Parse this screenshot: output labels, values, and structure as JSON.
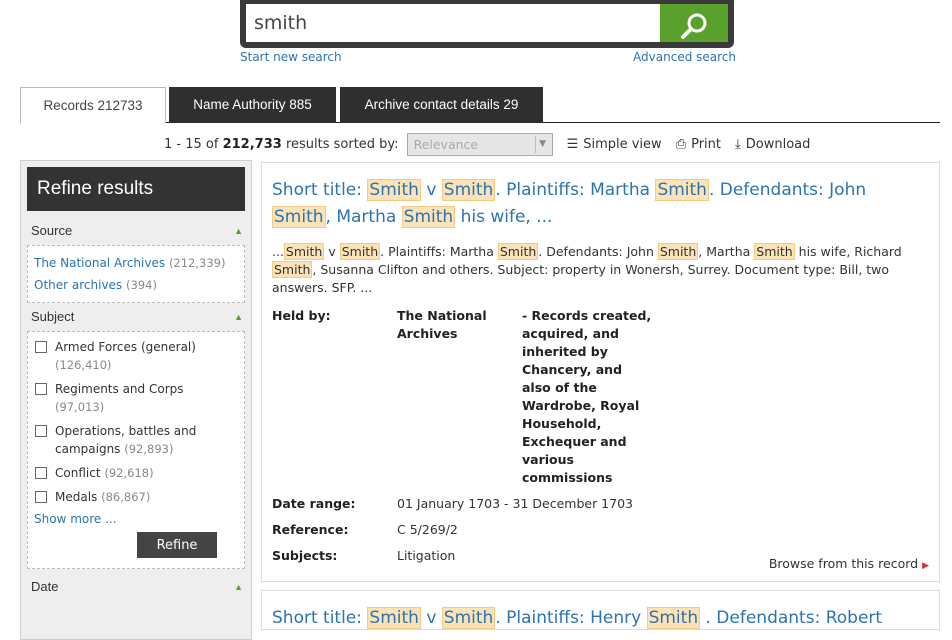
{
  "search": {
    "query": "smith",
    "start_new": "Start new search",
    "advanced": "Advanced search"
  },
  "tabs": [
    {
      "label": "Records 212733"
    },
    {
      "label": "Name Authority 885"
    },
    {
      "label": "Archive contact details 29"
    }
  ],
  "results_bar": {
    "range": "1 - 15 of",
    "total": "212,733",
    "sorted_by": "results sorted by:",
    "sort_value": "Relevance",
    "simple_view": "Simple view",
    "print": "Print",
    "download": "Download"
  },
  "sidebar": {
    "heading": "Refine results",
    "source": {
      "title": "Source",
      "items": [
        {
          "label": "The National Archives",
          "count": "(212,339)"
        },
        {
          "label": "Other archives",
          "count": "(394)"
        }
      ]
    },
    "subject": {
      "title": "Subject",
      "items": [
        {
          "label": "Armed Forces (general)",
          "count": "(126,410)"
        },
        {
          "label": "Regiments and Corps",
          "count": "(97,013)"
        },
        {
          "label": "Operations, battles and campaigns",
          "count": "(92,893)"
        },
        {
          "label": "Conflict",
          "count": "(92,618)"
        },
        {
          "label": "Medals",
          "count": "(86,867)"
        }
      ],
      "show_more": "Show more ...",
      "refine": "Refine"
    },
    "date": {
      "title": "Date"
    }
  },
  "result1": {
    "title_parts": [
      "Short title: ",
      "Smith",
      " v ",
      "Smith",
      ". Plaintiffs: Martha ",
      "Smith",
      ". Defendants: John ",
      "Smith",
      ", Martha ",
      "Smith",
      " his wife, ..."
    ],
    "desc_parts": [
      "...",
      "Smith",
      " v ",
      "Smith",
      ". Plaintiffs: Martha ",
      "Smith",
      ". Defendants: John ",
      "Smith",
      ", Martha ",
      "Smith",
      " his wife, Richard ",
      "Smith",
      ", Susanna Clifton and others. Subject: property in Wonersh, Surrey. Document type: Bill, two answers. SFP. ..."
    ],
    "held_by_label": "Held by:",
    "held_by": "The National Archives",
    "held_by_extra": "- Records created, acquired, and inherited by Chancery, and also of the Wardrobe, Royal Household, Exchequer and various commissions",
    "date_range_label": "Date range:",
    "date_range": "01 January 1703 - 31 December 1703",
    "reference_label": "Reference:",
    "reference": "C 5/269/2",
    "subjects_label": "Subjects:",
    "subjects": "Litigation",
    "browse": "Browse from this record"
  },
  "result2": {
    "title_parts": [
      "Short title: ",
      "Smith",
      " v ",
      "Smith",
      ". Plaintiffs: Henry ",
      "Smith",
      " . Defendants: Robert"
    ]
  },
  "colors": {
    "accent_green": "#5aa02c",
    "link_blue": "#2b74b1",
    "highlight": "#fbe3b7",
    "dark": "#333333"
  }
}
